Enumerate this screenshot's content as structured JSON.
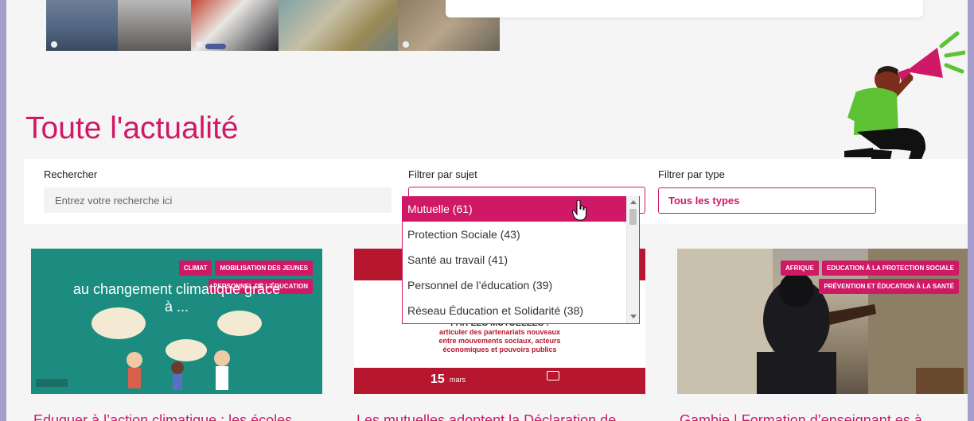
{
  "page": {
    "title": "Toute l'actualité"
  },
  "filters": {
    "search_label": "Rechercher",
    "search_placeholder": "Entrez votre recherche ici",
    "subject_label": "Filtrer par sujet",
    "type_label": "Filtrer par type",
    "type_value": "Tous les types",
    "subject_options": [
      {
        "label": "Mutuelle  (61)",
        "selected": true
      },
      {
        "label": "Protection Sociale  (43)",
        "selected": false
      },
      {
        "label": "Santé au travail  (41)",
        "selected": false
      },
      {
        "label": "Personnel de l’éducation  (39)",
        "selected": false
      },
      {
        "label": "Réseau Éducation et Solidarité  (38)",
        "selected": false
      }
    ]
  },
  "cards": [
    {
      "tags": [
        "Climat",
        "Mobilisation des jeunes",
        "Personnel de l’éducation"
      ],
      "headline_line1": "au changement climatique grâce",
      "headline_line2": "à ...",
      "title": "Eduquer à l’action climatique : les écoles"
    },
    {
      "tags": [],
      "image_text_main": "PAR LES MUTUELLES :",
      "image_text_sub1": "articuler des partenariats nouveaux",
      "image_text_sub2": "entre mouvements sociaux, acteurs",
      "image_text_sub3": "économiques et pouvoirs publics",
      "date_day": "15",
      "date_month": "mars",
      "title": "Les mutuelles adoptent la Déclaration de"
    },
    {
      "tags": [
        "Afrique",
        "Education à la protection sociale",
        "Prévention et éducation à la santé"
      ],
      "title": "Gambie | Formation d’enseignant.es à"
    }
  ],
  "colors": {
    "accent": "#d01966",
    "frame": "#a59dcb",
    "background": "#f5f5f5",
    "card1_bg": "#1d8c80"
  }
}
